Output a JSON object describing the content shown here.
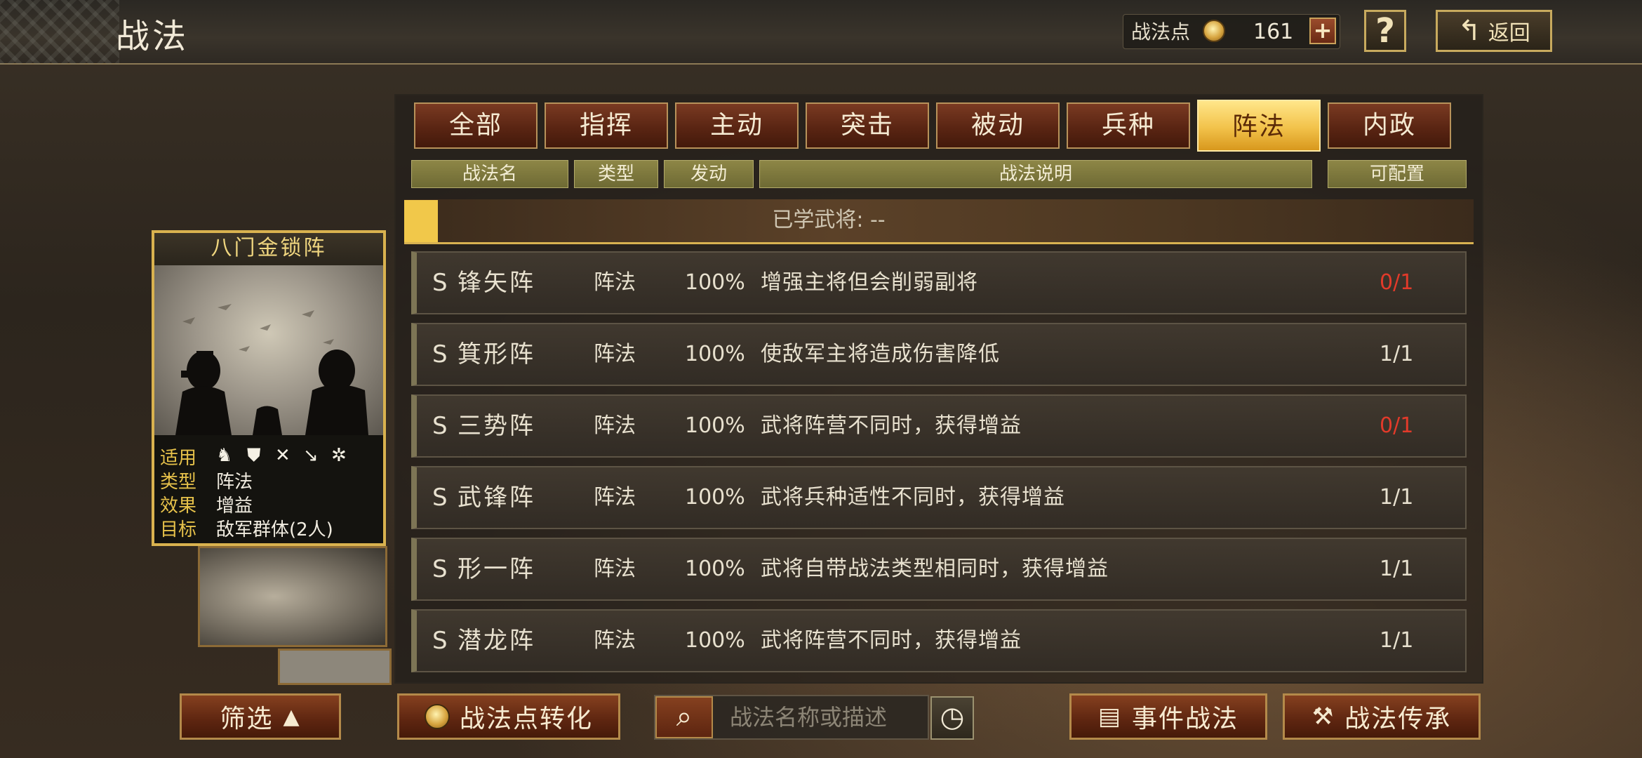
{
  "header": {
    "title": "战法",
    "points_label": "战法点",
    "points_value": "161",
    "plus_label": "+",
    "help_label": "?",
    "back_label": "返回"
  },
  "tabs": [
    {
      "label": "全部",
      "active": false
    },
    {
      "label": "指挥",
      "active": false
    },
    {
      "label": "主动",
      "active": false
    },
    {
      "label": "突击",
      "active": false
    },
    {
      "label": "被动",
      "active": false
    },
    {
      "label": "兵种",
      "active": false
    },
    {
      "label": "阵法",
      "active": true
    },
    {
      "label": "内政",
      "active": false
    }
  ],
  "columns": {
    "name": "战法名",
    "type": "类型",
    "trigger": "发动",
    "description": "战法说明",
    "configurable": "可配置"
  },
  "learned": "已学武将: --",
  "rows": [
    {
      "grade": "S",
      "name": "锋矢阵",
      "type": "阵法",
      "rate": "100%",
      "desc": "增强主将但会削弱副将",
      "cfg": "0/1",
      "cfg_red": true
    },
    {
      "grade": "S",
      "name": "箕形阵",
      "type": "阵法",
      "rate": "100%",
      "desc": "使敌军主将造成伤害降低",
      "cfg": "1/1",
      "cfg_red": false
    },
    {
      "grade": "S",
      "name": "三势阵",
      "type": "阵法",
      "rate": "100%",
      "desc": "武将阵营不同时，获得增益",
      "cfg": "0/1",
      "cfg_red": true
    },
    {
      "grade": "S",
      "name": "武锋阵",
      "type": "阵法",
      "rate": "100%",
      "desc": "武将兵种适性不同时，获得增益",
      "cfg": "1/1",
      "cfg_red": false
    },
    {
      "grade": "S",
      "name": "形一阵",
      "type": "阵法",
      "rate": "100%",
      "desc": "武将自带战法类型相同时，获得增益",
      "cfg": "1/1",
      "cfg_red": false
    },
    {
      "grade": "S",
      "name": "潜龙阵",
      "type": "阵法",
      "rate": "100%",
      "desc": "武将阵营不同时，获得增益",
      "cfg": "1/1",
      "cfg_red": false
    }
  ],
  "card": {
    "title": "八门金锁阵",
    "apply_label": "适用",
    "type_label": "类型",
    "type_value": "阵法",
    "effect_label": "效果",
    "effect_value": "增益",
    "target_label": "目标",
    "target_value": "敌军群体(2人)",
    "unit_icons": [
      "cavalry-icon",
      "shield-icon",
      "bow-icon",
      "spear-icon",
      "wheel-icon"
    ]
  },
  "bottom": {
    "filter_label": "筛选",
    "convert_label": "战法点转化",
    "search_placeholder": "战法名称或描述",
    "event_label": "事件战法",
    "inherit_label": "战法传承"
  },
  "colors": {
    "accent_gold": "#f2c24a",
    "tab_brown": "#5a2513",
    "warn_red": "#e23a2a"
  }
}
